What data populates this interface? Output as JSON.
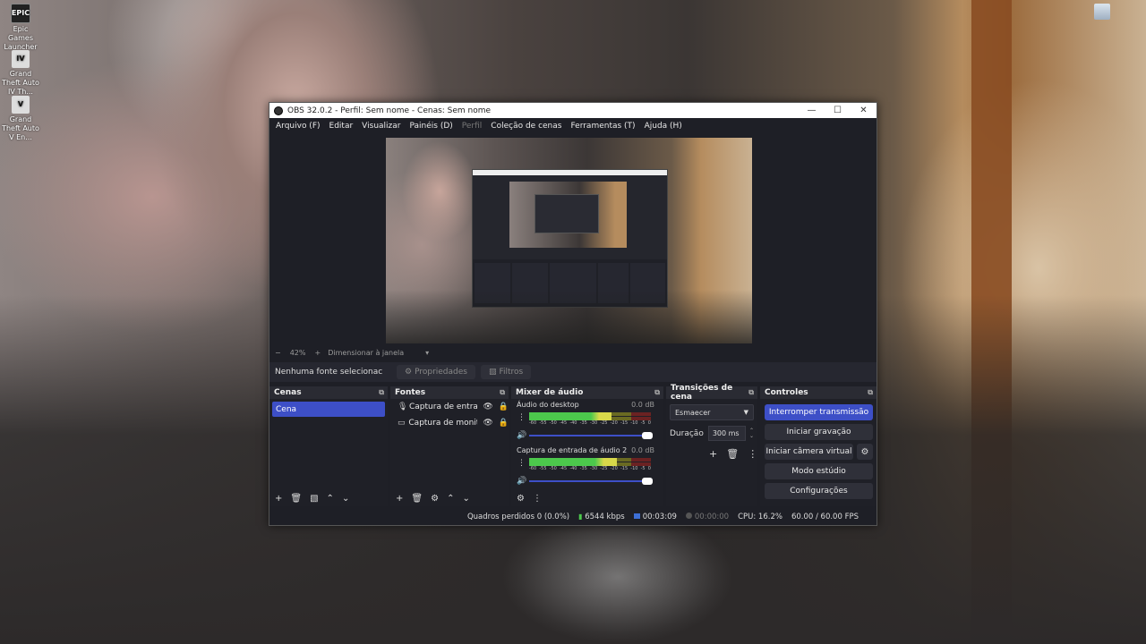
{
  "desktop": {
    "icons": [
      {
        "label": "Epic Games Launcher",
        "icon": "epic-games-icon",
        "badge": "EPIC"
      },
      {
        "label": "Grand Theft Auto IV Th...",
        "icon": "gta-iv-icon",
        "badge": "IV"
      },
      {
        "label": "Grand Theft Auto V En...",
        "icon": "gta-v-icon",
        "badge": "V"
      }
    ]
  },
  "window": {
    "title": "OBS 32.0.2 - Perfil: Sem nome - Cenas: Sem nome",
    "controls": {
      "minimize": "—",
      "maximize": "☐",
      "close": "✕"
    }
  },
  "menu": [
    "Arquivo (F)",
    "Editar",
    "Visualizar",
    "Painéis (D)",
    "Perfil",
    "Coleção de cenas",
    "Ferramentas (T)",
    "Ajuda (H)"
  ],
  "preview": {
    "zoom_minus": "−",
    "zoom_value": "42%",
    "zoom_plus": "+",
    "fit_label": "Dimensionar à janela",
    "fit_arrow": "▾"
  },
  "source_toolbar": {
    "no_source": "Nenhuma fonte selecionac",
    "properties": "Propriedades",
    "filters": "Filtros"
  },
  "docks": {
    "scenes": {
      "title": "Cenas",
      "items": [
        "Cena"
      ]
    },
    "sources": {
      "title": "Fontes",
      "items": [
        {
          "label": "Captura de entrada",
          "icon": "microphone-icon"
        },
        {
          "label": "Captura de monitor",
          "icon": "monitor-icon"
        }
      ]
    },
    "mixer": {
      "title": "Mixer de áudio",
      "channels": [
        {
          "name": "Áudio do desktop",
          "db": "0.0 dB",
          "level": 0.68
        },
        {
          "name": "Captura de entrada de áudio 2",
          "db": "0.0 dB",
          "level": 0.72
        }
      ],
      "ticks": [
        "-60",
        "-55",
        "-50",
        "-45",
        "-40",
        "-35",
        "-30",
        "-25",
        "-20",
        "-15",
        "-10",
        "-5",
        "0"
      ]
    },
    "transitions": {
      "title": "Transições de cena",
      "selected": "Esmaecer",
      "duration_label": "Duração",
      "duration_value": "300 ms"
    },
    "controls": {
      "title": "Controles",
      "buttons": {
        "stop_stream": "Interromper transmissão",
        "start_record": "Iniciar gravação",
        "virtual_cam": "Iniciar câmera virtual",
        "studio": "Modo estúdio",
        "settings": "Configurações"
      }
    }
  },
  "status": {
    "dropped": "Quadros perdidos 0 (0.0%)",
    "bitrate": "6544 kbps",
    "stream_time": "00:03:09",
    "record_time": "00:00:00",
    "cpu": "CPU: 16.2%",
    "fps": "60.00 / 60.00 FPS"
  },
  "colors": {
    "accent": "#3d4fc7",
    "bg": "#1e1f26",
    "dock": "#1f2027"
  }
}
